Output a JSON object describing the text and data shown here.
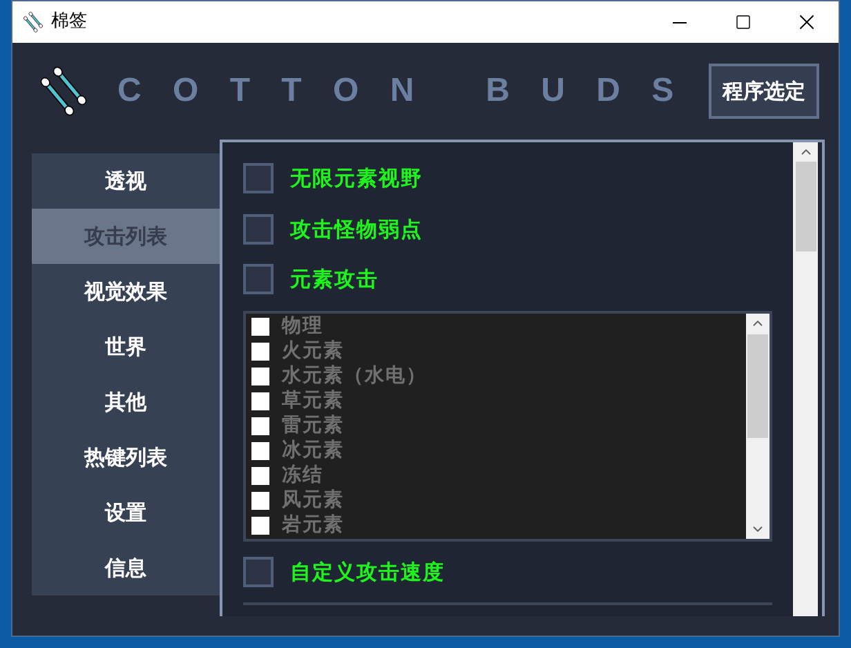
{
  "window": {
    "title": "棉签"
  },
  "header": {
    "logo_text": "C O T T O N   B U D S",
    "button": "程序选定"
  },
  "sidebar": {
    "items": [
      {
        "label": "透视",
        "selected": false
      },
      {
        "label": "攻击列表",
        "selected": true
      },
      {
        "label": "视觉效果",
        "selected": false
      },
      {
        "label": "世界",
        "selected": false
      },
      {
        "label": "其他",
        "selected": false
      },
      {
        "label": "热键列表",
        "selected": false
      },
      {
        "label": "设置",
        "selected": false
      },
      {
        "label": "信息",
        "selected": false
      }
    ]
  },
  "options": [
    {
      "kind": "checkbox",
      "label": "无限元素视野",
      "checked": false
    },
    {
      "kind": "checkbox",
      "label": "攻击怪物弱点",
      "checked": false
    },
    {
      "kind": "checkbox",
      "label": "元素攻击",
      "checked": false
    },
    {
      "kind": "list",
      "items": [
        {
          "label": "物理",
          "checked": false
        },
        {
          "label": "火元素",
          "checked": false
        },
        {
          "label": "水元素（水电）",
          "checked": false
        },
        {
          "label": "草元素",
          "checked": false
        },
        {
          "label": "雷元素",
          "checked": false
        },
        {
          "label": "冰元素",
          "checked": false
        },
        {
          "label": "冻结",
          "checked": false
        },
        {
          "label": "风元素",
          "checked": false
        },
        {
          "label": "岩元素",
          "checked": false
        }
      ]
    },
    {
      "kind": "checkbox",
      "label": "自定义攻击速度",
      "checked": false
    }
  ]
}
